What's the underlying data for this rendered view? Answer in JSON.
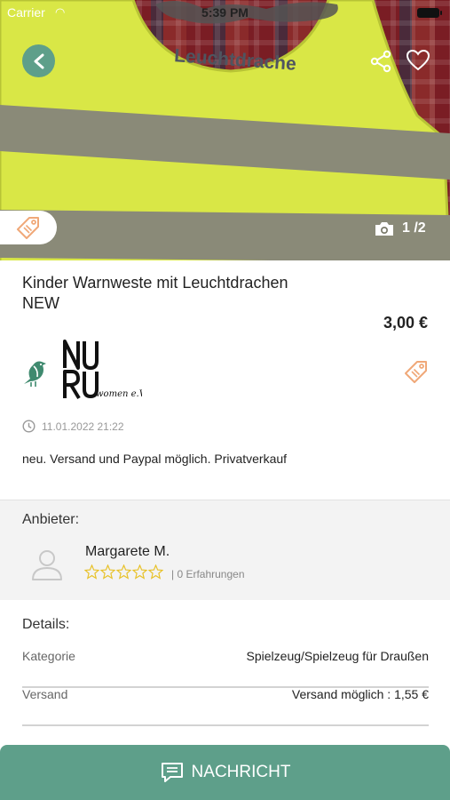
{
  "status_bar": {
    "carrier": "Carrier",
    "time": "5:39 PM"
  },
  "hero": {
    "vest_print": "Leuchtdrache",
    "photo_counter": "1 /2"
  },
  "product": {
    "title_line1": "Kinder Warnweste mit Leuchtdrachen",
    "title_line2": "NEW",
    "price": "3,00 €",
    "org_logo_text": "NURU women e.V",
    "date": "11.01.2022 21:22",
    "description": "neu. Versand und Paypal möglich. Privatverkauf"
  },
  "seller": {
    "label": "Anbieter:",
    "name": "Margarete M.",
    "rating": 0,
    "rating_max": 5,
    "experience": "| 0 Erfahrungen"
  },
  "details": {
    "label": "Details:",
    "rows": [
      {
        "key": "Kategorie",
        "value": "Spielzeug/Spielzeug für Draußen"
      },
      {
        "key": "Versand",
        "value": "Versand möglich : 1,55 €"
      }
    ]
  },
  "actions": {
    "message_label": "NACHRICHT"
  },
  "colors": {
    "accent": "#5e9f8a",
    "tag_orange": "#f0a878",
    "star_yellow": "#e8c22a",
    "vest_yellow": "#d8e840"
  },
  "icons": [
    "back-arrow-icon",
    "share-icon",
    "heart-icon",
    "price-tag-icon",
    "camera-icon",
    "bird-icon",
    "clock-icon",
    "user-avatar-icon",
    "star-icon",
    "chat-icon"
  ]
}
